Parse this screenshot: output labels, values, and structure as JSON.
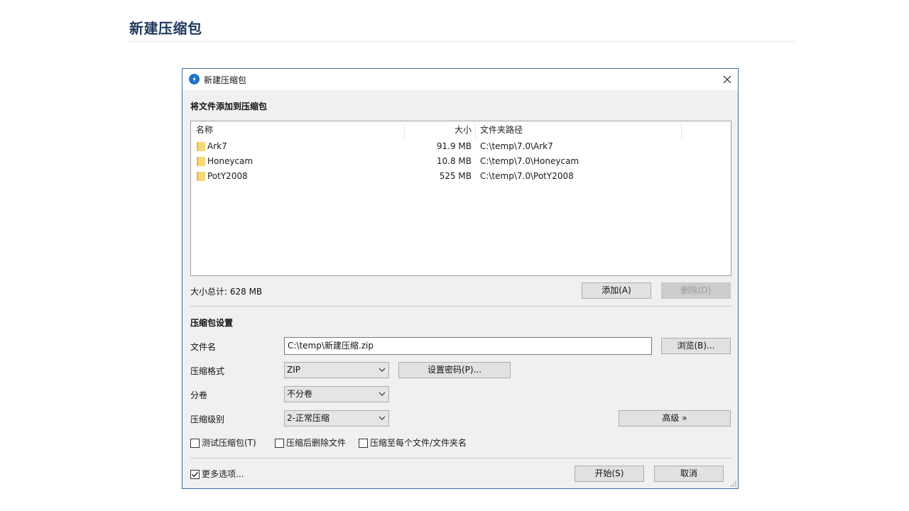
{
  "page": {
    "title": "新建压缩包"
  },
  "dialog": {
    "title": "新建压缩包",
    "add_files_label": "将文件添加到压缩包",
    "columns": {
      "name": "名称",
      "size": "大小",
      "path": "文件夹路径"
    },
    "files": [
      {
        "name": "Ark7",
        "size": "91.9 MB",
        "path": "C:\\temp\\7.0\\Ark7"
      },
      {
        "name": "Honeycam",
        "size": "10.8 MB",
        "path": "C:\\temp\\7.0\\Honeycam"
      },
      {
        "name": "PotY2008",
        "size": "525 MB",
        "path": "C:\\temp\\7.0\\PotY2008"
      }
    ],
    "total_size": "大小总计: 628 MB",
    "add_button": "添加(A)",
    "delete_button": "删除(D)",
    "settings_label": "压缩包设置",
    "filename_label": "文件名",
    "filename_value": "C:\\temp\\新建压缩.zip",
    "browse_button": "浏览(B)...",
    "format_label": "压缩格式",
    "format_value": "ZIP",
    "password_button": "设置密码(P)...",
    "split_label": "分卷",
    "split_value": "不分卷",
    "level_label": "压缩级别",
    "level_value": "2-正常压缩",
    "advanced_button": "高级 »",
    "options": [
      {
        "label": "测试压缩包(T)",
        "checked": false
      },
      {
        "label": "压缩后删除文件",
        "checked": false
      },
      {
        "label": "压缩至每个文件/文件夹名",
        "checked": false
      }
    ],
    "more_options": {
      "label": "更多选项...",
      "checked": true
    },
    "start_button": "开始(S)",
    "cancel_button": "取消"
  },
  "colors": {
    "accent": "#1a73c9",
    "folder": "#f8d775",
    "title": "#1d3a5c"
  }
}
